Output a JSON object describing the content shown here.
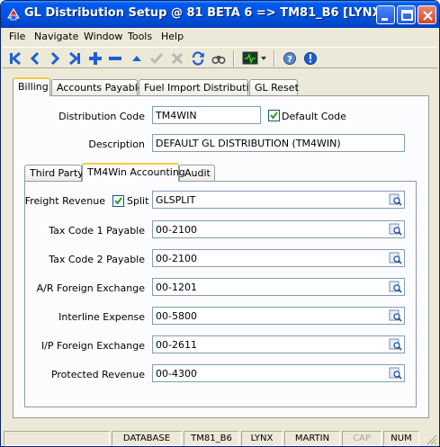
{
  "window": {
    "title": "GL Distribution Setup @ 81 BETA 6 => TM81_B6 [LYNX]"
  },
  "menu": [
    "File",
    "Navigate",
    "Window",
    "Tools",
    "Help"
  ],
  "toolbar_icons": [
    "first-record",
    "previous-record",
    "next-record",
    "last-record",
    "add-record",
    "delete-record",
    "move-up",
    "save-check",
    "cancel-x",
    "refresh",
    "find-binoculars",
    "monitor-dropdown",
    "help",
    "info"
  ],
  "outer_tabs": [
    "Billing",
    "Accounts Payable",
    "Fuel Import Distribution",
    "GL Reset"
  ],
  "billing": {
    "distribution_code_label": "Distribution Code",
    "distribution_code_value": "TM4WIN",
    "default_code_label": "Default Code",
    "default_code_checked": true,
    "description_label": "Description",
    "description_value": "DEFAULT GL DISTRIBUTION (TM4WIN)"
  },
  "inner_tabs": [
    "Third Party",
    "TM4Win Accounting",
    "Audit"
  ],
  "accounting": {
    "freight_revenue_label": "Freight Revenue",
    "split_label": "Split",
    "split_checked": true,
    "freight_revenue_value": "GLSPLIT",
    "rows": [
      {
        "label": "Tax Code 1 Payable",
        "value": "00-2100"
      },
      {
        "label": "Tax Code 2 Payable",
        "value": "00-2100"
      },
      {
        "label": "A/R Foreign Exchange",
        "value": "00-1201"
      },
      {
        "label": "Interline Expense",
        "value": "00-5800"
      },
      {
        "label": "I/P Foreign Exchange",
        "value": "00-2611"
      },
      {
        "label": "Protected Revenue",
        "value": "00-4300"
      }
    ]
  },
  "status": [
    "DATABASE",
    "TM81_B6",
    "LYNX",
    "MARTIN",
    "CAP",
    "NUM"
  ],
  "colors": {
    "title_bar": "#0054e3",
    "active_tab_accent": "#ffc83c",
    "field_border": "#7f9db9"
  }
}
